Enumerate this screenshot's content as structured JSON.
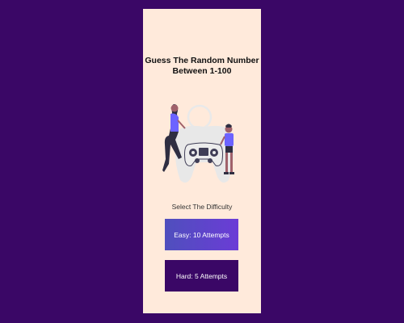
{
  "game": {
    "title_line1": "Guess The Random Number",
    "title_line2": "Between 1-100",
    "difficulty_prompt": "Select The Difficulty",
    "easy_label": "Easy: 10 Attempts",
    "hard_label": "Hard: 5 Attempts"
  },
  "colors": {
    "page_background": "#3a0766",
    "card_background": "#ffeadb",
    "easy_button_start": "#4f4fbd",
    "easy_button_end": "#6b3cd6",
    "hard_button": "#3a0766",
    "accent_purple": "#6c63ff"
  },
  "icons": {
    "illustration": "people-with-game-controller-illustration"
  }
}
